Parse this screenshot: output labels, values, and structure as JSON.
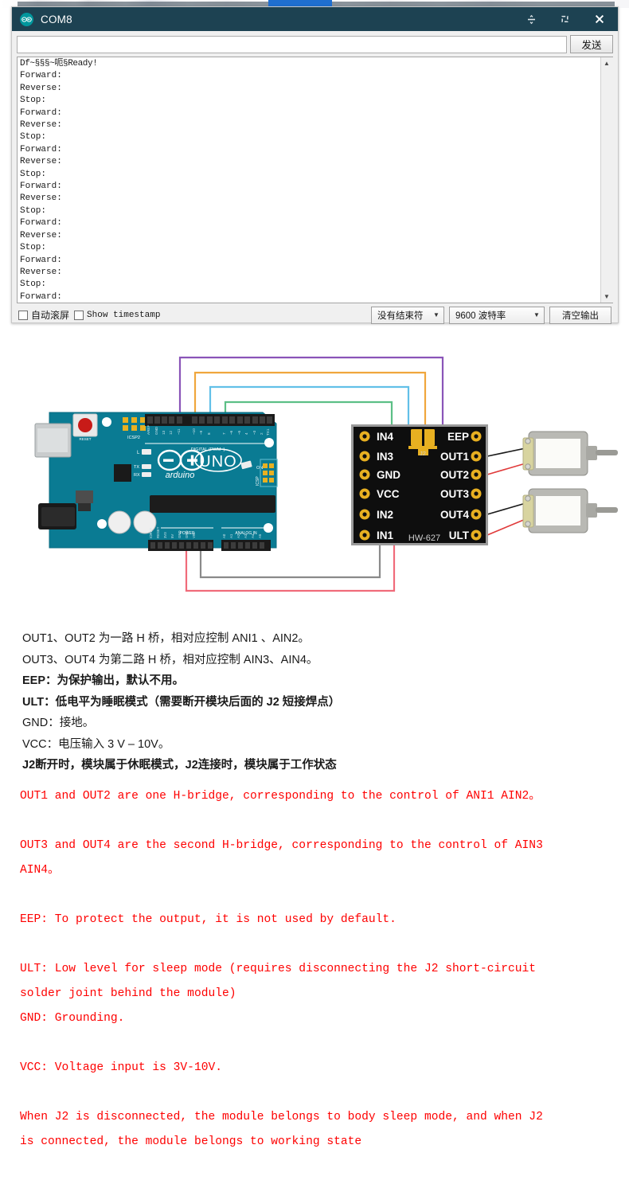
{
  "window": {
    "title": "COM8",
    "logo_icon": "arduino-infinity-icon",
    "minimize_label": "–",
    "maximize_label": "❐",
    "close_label": "✕"
  },
  "send_row": {
    "input_value": "",
    "input_placeholder": "",
    "send_label": "发送"
  },
  "console": {
    "lines": [
      "Df~§§§~呃§Ready!",
      "Forward:",
      "Reverse:",
      "Stop:",
      "Forward:",
      "Reverse:",
      "Stop:",
      "Forward:",
      "Reverse:",
      "Stop:",
      "Forward:",
      "Reverse:",
      "Stop:",
      "Forward:",
      "Reverse:",
      "Stop:",
      "Forward:",
      "Reverse:",
      "Stop:",
      "Forward:"
    ],
    "scroll_up_icon": "caret-up-icon",
    "scroll_down_icon": "caret-down-icon"
  },
  "bottom_bar": {
    "autoscroll_label": "自动滚屏",
    "timestamp_label": "Show timestamp",
    "line_ending_value": "没有结束符",
    "baud_value": "9600 波特率",
    "clear_label": "清空输出",
    "dropdown_icon": "chevron-down-icon"
  },
  "diagram": {
    "board_name": "UNO",
    "board_brand": "Arduino",
    "board_reset_label": "RESET",
    "board_icsp_label": "ICSP",
    "board_icsp2_label": "ICSP2",
    "board_digital_label": "DIGITAL (PWM~)",
    "board_power_label": "POWER",
    "board_analog_label": "ANALOG IN",
    "board_led_l": "L",
    "board_led_tx": "TX",
    "board_led_rx": "RX",
    "board_led_on": "ON",
    "module_part": "HW-627",
    "module_jumper": "J2",
    "module_left_pins": [
      "IN4",
      "IN3",
      "GND",
      "VCC",
      "IN2",
      "IN1"
    ],
    "module_right_pins": [
      "EEP",
      "OUT1",
      "OUT2",
      "OUT3",
      "OUT4",
      "ULT"
    ],
    "wire_colors": {
      "purple": "#8a54b8",
      "orange": "#f0a63c",
      "lightblue": "#62c0e8",
      "green": "#5cbf86",
      "red": "#f06b7a",
      "gray": "#8a8a8a"
    },
    "board_color": "#0a7b93",
    "module_color": "#141414",
    "pad_color": "#e8b021"
  },
  "chinese_notes": [
    {
      "text": "OUT1、OUT2 为一路 H 桥，相对应控制 ANI1 、AIN2。",
      "bold": false
    },
    {
      "text": "OUT3、OUT4 为第二路 H 桥，相对应控制 AIN3、AIN4。",
      "bold": false
    },
    {
      "text": "EEP：为保护输出，默认不用。",
      "bold": true
    },
    {
      "text": "ULT：低电平为睡眠模式（需要断开模块后面的 J2 短接焊点）",
      "bold": true
    },
    {
      "text": "GND：接地。",
      "bold": false
    },
    {
      "text": "VCC：电压输入 3 V – 10V。",
      "bold": false
    },
    {
      "text": "J2断开时，模块属于休眠模式，J2连接时，模块属于工作状态",
      "bold": true
    }
  ],
  "english_notes": [
    "OUT1 and OUT2 are one H-bridge, corresponding to the control of ANI1 AIN2。",
    "",
    "OUT3 and OUT4 are the second H-bridge, corresponding to the control of AIN3",
    "AIN4。",
    "",
    "EEP: To protect the output, it is not used by default.",
    "",
    "ULT: Low level for sleep mode (requires disconnecting the J2 short-circuit",
    "solder joint behind the module)",
    "GND: Grounding.",
    "",
    "VCC: Voltage input is 3V-10V.",
    "",
    "When J2 is disconnected, the module belongs to body sleep mode, and when J2",
    "is connected, the module belongs to working state"
  ]
}
